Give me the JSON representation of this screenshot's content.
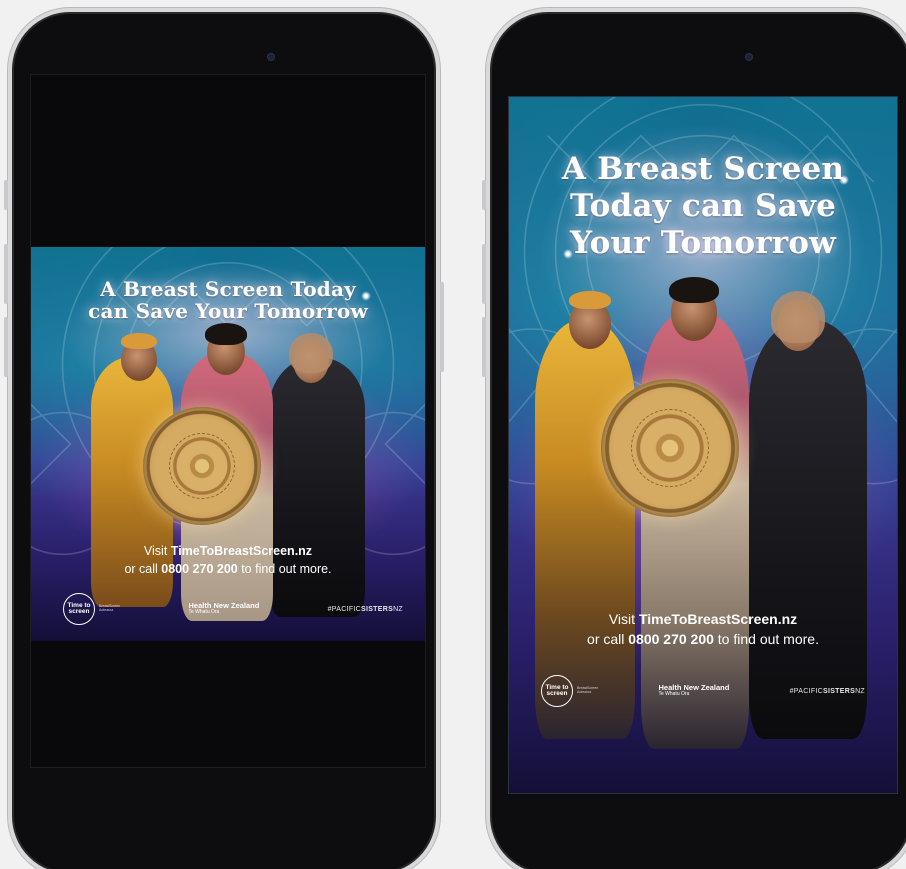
{
  "headline": {
    "left_line1": "A Breast Screen Today",
    "left_line2": "can Save Your Tomorrow",
    "right_line1": "A Breast Screen",
    "right_line2": "Today can Save",
    "right_line3": "Your Tomorrow"
  },
  "cta": {
    "visit_prefix": "Visit ",
    "website": "TimeToBreastScreen.nz",
    "call_prefix": "or call ",
    "phone": "0800 270 200",
    "call_suffix": " to find out more."
  },
  "logos": {
    "tts_line1": "Time to",
    "tts_line2": "screen",
    "tts_sub1": "BreastScreen",
    "tts_sub2": "Aotearoa",
    "hnz_main": "Health New Zealand",
    "hnz_sub": "Te Whatu Ora",
    "hashtag_prefix": "#PACIFIC",
    "hashtag_bold": "SISTERS",
    "hashtag_suffix": "NZ"
  },
  "colors": {
    "poster_top": "#0f6f8f",
    "poster_mid": "#3b3b95",
    "poster_bottom": "#140f38",
    "phone_frame": "#d9d9dc",
    "phone_body": "#0d0d0f",
    "shield_gold": "#d5aa62"
  }
}
